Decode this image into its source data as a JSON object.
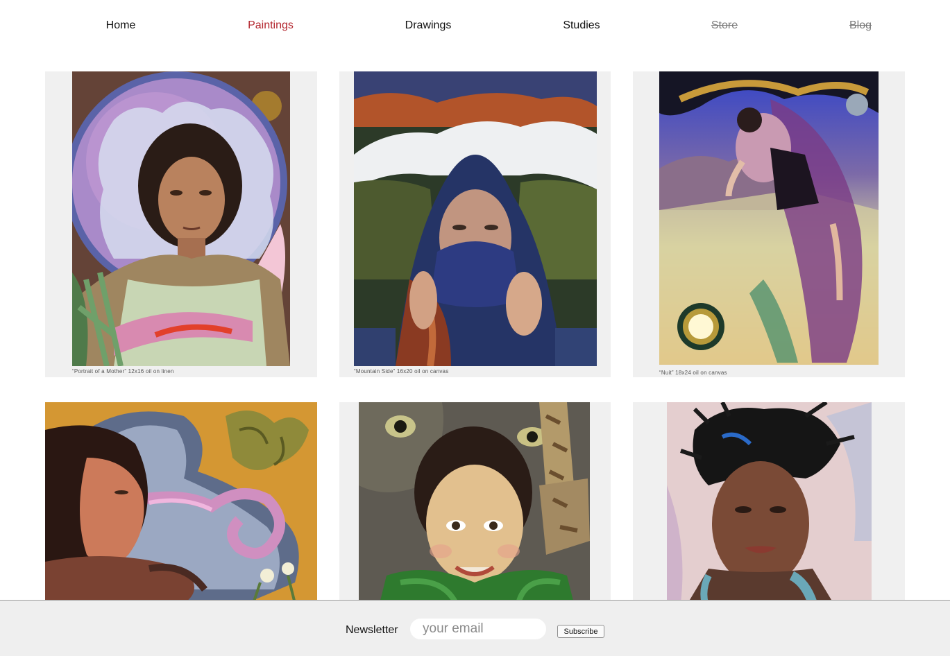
{
  "nav": {
    "items": [
      {
        "label": "Home",
        "state": "normal"
      },
      {
        "label": "Paintings",
        "state": "active"
      },
      {
        "label": "Drawings",
        "state": "normal"
      },
      {
        "label": "Studies",
        "state": "normal"
      },
      {
        "label": "Store",
        "state": "struck"
      },
      {
        "label": "Blog",
        "state": "struck"
      }
    ],
    "active_color": "#b3262e"
  },
  "gallery": {
    "paintings": [
      {
        "caption": "“Portrait of a Mother”  12x16  oil on linen"
      },
      {
        "caption": "“Mountain Side”  16x20  oil on canvas"
      },
      {
        "caption": "“Nuit”  18x24  oil on canvas"
      },
      {
        "caption": ""
      },
      {
        "caption": ""
      },
      {
        "caption": ""
      }
    ],
    "tile_background": "#f0f0f0"
  },
  "footer": {
    "newsletter_label": "Newsletter",
    "email_placeholder": "your email",
    "subscribe_label": "Subscribe"
  }
}
